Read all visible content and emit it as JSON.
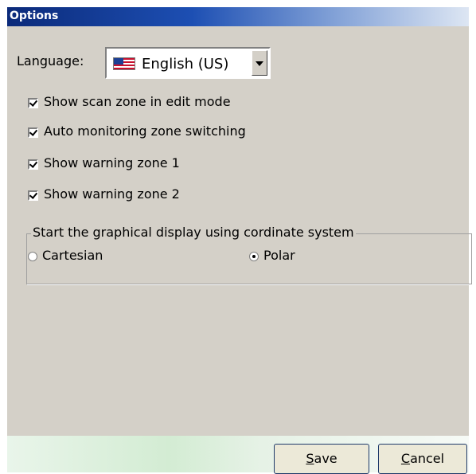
{
  "dialog": {
    "title": "Options"
  },
  "language": {
    "label": "Language:",
    "selected": "English (US)",
    "flag_icon": "us-flag-icon"
  },
  "checkboxes": [
    {
      "label": "Show scan zone in edit mode",
      "checked": true
    },
    {
      "label": "Auto monitoring zone switching",
      "checked": true
    },
    {
      "label": "Show warning zone 1",
      "checked": true
    },
    {
      "label": "Show warning zone 2",
      "checked": true
    }
  ],
  "coordinate_group": {
    "title": "Start the graphical display using cordinate system",
    "options": [
      {
        "label": "Cartesian",
        "selected": false
      },
      {
        "label": "Polar",
        "selected": true
      }
    ]
  },
  "buttons": {
    "save_rest": "ave",
    "save_mnemonic": "S",
    "cancel_rest": "ancel",
    "cancel_mnemonic": "C"
  },
  "colors": {
    "title_bar": "#0b2a7a",
    "dialog_bg": "#d4d0c8",
    "footer": "#d3ecd3"
  }
}
